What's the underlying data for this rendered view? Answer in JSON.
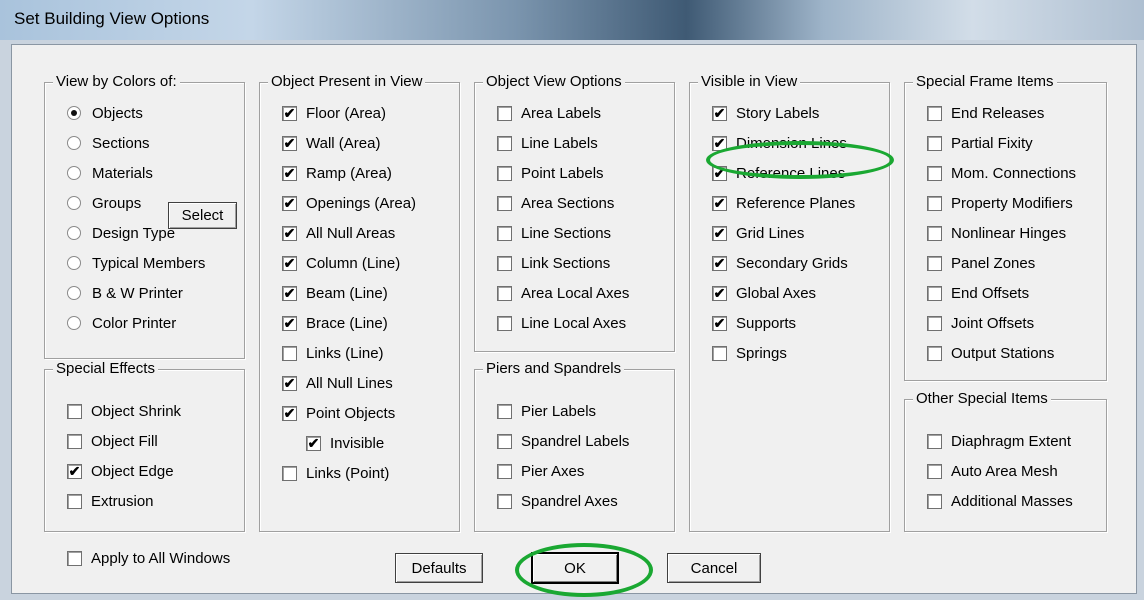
{
  "window": {
    "title": "Set Building View Options"
  },
  "view_by_colors": {
    "title": "View by Colors of:",
    "options": [
      {
        "label": "Objects",
        "selected": true
      },
      {
        "label": "Sections",
        "selected": false
      },
      {
        "label": "Materials",
        "selected": false
      },
      {
        "label": "Groups",
        "selected": false
      },
      {
        "label": "Design Type",
        "selected": false
      },
      {
        "label": "Typical Members",
        "selected": false
      },
      {
        "label": "B & W Printer",
        "selected": false
      },
      {
        "label": "Color Printer",
        "selected": false
      }
    ],
    "select_button": "Select"
  },
  "special_effects": {
    "title": "Special Effects",
    "items": [
      {
        "label": "Object Shrink",
        "checked": false
      },
      {
        "label": "Object Fill",
        "checked": false
      },
      {
        "label": "Object Edge",
        "checked": true
      },
      {
        "label": "Extrusion",
        "checked": false
      }
    ]
  },
  "object_present": {
    "title": "Object Present in View",
    "items": [
      {
        "label": "Floor (Area)",
        "checked": true
      },
      {
        "label": "Wall (Area)",
        "checked": true
      },
      {
        "label": "Ramp (Area)",
        "checked": true
      },
      {
        "label": "Openings (Area)",
        "checked": true
      },
      {
        "label": "All Null Areas",
        "checked": true
      },
      {
        "label": "Column (Line)",
        "checked": true
      },
      {
        "label": "Beam (Line)",
        "checked": true
      },
      {
        "label": "Brace (Line)",
        "checked": true
      },
      {
        "label": "Links (Line)",
        "checked": false
      },
      {
        "label": "All Null Lines",
        "checked": true
      },
      {
        "label": "Point Objects",
        "checked": true
      },
      {
        "label": "Invisible",
        "checked": true
      },
      {
        "label": "Links (Point)",
        "checked": false
      }
    ]
  },
  "object_view_options": {
    "title": "Object View Options",
    "items": [
      {
        "label": "Area Labels",
        "checked": false
      },
      {
        "label": "Line Labels",
        "checked": false
      },
      {
        "label": "Point Labels",
        "checked": false
      },
      {
        "label": "Area Sections",
        "checked": false
      },
      {
        "label": "Line Sections",
        "checked": false
      },
      {
        "label": "Link Sections",
        "checked": false
      },
      {
        "label": "Area Local Axes",
        "checked": false
      },
      {
        "label": "Line Local Axes",
        "checked": false
      }
    ]
  },
  "piers_spandrels": {
    "title": "Piers and Spandrels",
    "items": [
      {
        "label": "Pier Labels",
        "checked": false
      },
      {
        "label": "Spandrel Labels",
        "checked": false
      },
      {
        "label": "Pier Axes",
        "checked": false
      },
      {
        "label": "Spandrel Axes",
        "checked": false
      }
    ]
  },
  "visible_in_view": {
    "title": "Visible in View",
    "items": [
      {
        "label": "Story Labels",
        "checked": true
      },
      {
        "label": "Dimension Lines",
        "checked": true
      },
      {
        "label": "Reference Lines",
        "checked": true
      },
      {
        "label": "Reference Planes",
        "checked": true
      },
      {
        "label": "Grid Lines",
        "checked": true
      },
      {
        "label": "Secondary Grids",
        "checked": true
      },
      {
        "label": "Global Axes",
        "checked": true
      },
      {
        "label": "Supports",
        "checked": true
      },
      {
        "label": "Springs",
        "checked": false
      }
    ]
  },
  "special_frame": {
    "title": "Special Frame Items",
    "items": [
      {
        "label": "End Releases",
        "checked": false
      },
      {
        "label": "Partial Fixity",
        "checked": false
      },
      {
        "label": "Mom. Connections",
        "checked": false
      },
      {
        "label": "Property Modifiers",
        "checked": false
      },
      {
        "label": "Nonlinear Hinges",
        "checked": false
      },
      {
        "label": "Panel Zones",
        "checked": false
      },
      {
        "label": "End Offsets",
        "checked": false
      },
      {
        "label": "Joint Offsets",
        "checked": false
      },
      {
        "label": "Output Stations",
        "checked": false
      }
    ]
  },
  "other_special": {
    "title": "Other Special Items",
    "items": [
      {
        "label": "Diaphragm Extent",
        "checked": false
      },
      {
        "label": "Auto Area Mesh",
        "checked": false
      },
      {
        "label": "Additional Masses",
        "checked": false
      }
    ]
  },
  "footer": {
    "apply_all": {
      "label": "Apply to All Windows",
      "checked": false
    },
    "defaults": "Defaults",
    "ok": "OK",
    "cancel": "Cancel"
  },
  "colors": {
    "highlight": "#1aa832",
    "dialog_bg": "#f0f0f0"
  },
  "icons": {
    "check_mark": "check-icon",
    "radio_dot": "radio-dot-icon"
  }
}
